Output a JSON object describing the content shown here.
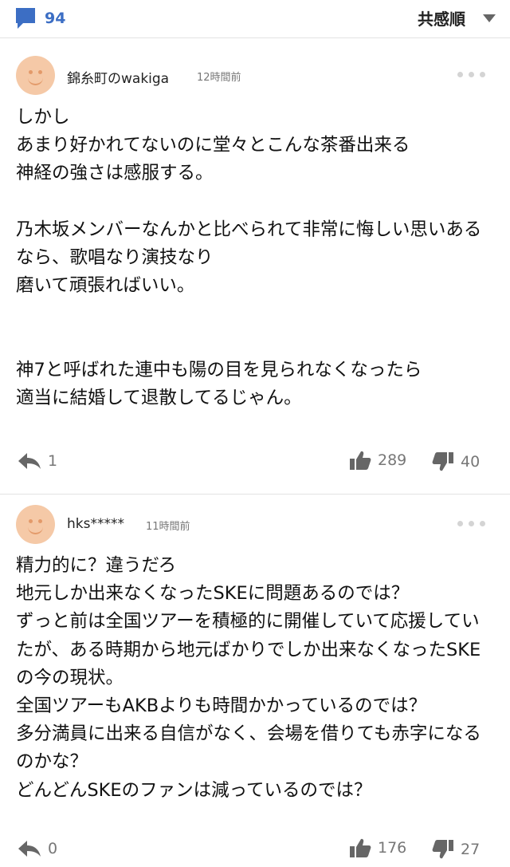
{
  "header": {
    "comment_count": "94",
    "sort_label": "共感順"
  },
  "comments": [
    {
      "user": "錦糸町のwakiga",
      "time": "12時間前",
      "text": "しかし\nあまり好かれてないのに堂々とこんな茶番出来る\n神経の強さは感服する。\n\n乃木坂メンバーなんかと比べられて非常に悔しい思いあるなら、歌唱なり演技なり\n磨いて頑張ればいい。\n\n\n神7と呼ばれた連中も陽の目を見られなくなったら\n適当に結婚して退散してるじゃん。",
      "replies": "1",
      "likes": "289",
      "dislikes": "40"
    },
    {
      "user": "hks*****",
      "time": "11時間前",
      "text": "精力的に？違うだろ\n地元しか出来なくなったSKEに問題あるのでは？\nずっと前は全国ツアーを積極的に開催していて応援していたが、ある時期から地元ばかりでしか出来なくなったSKEの今の現状。\n全国ツアーもAKBよりも時間かかっているのでは？\n多分満員に出来る自信がなく、会場を借りても赤字になるのかな？\nどんどんSKEのファンは減っているのでは？",
      "replies": "0",
      "likes": "176",
      "dislikes": "27"
    }
  ]
}
